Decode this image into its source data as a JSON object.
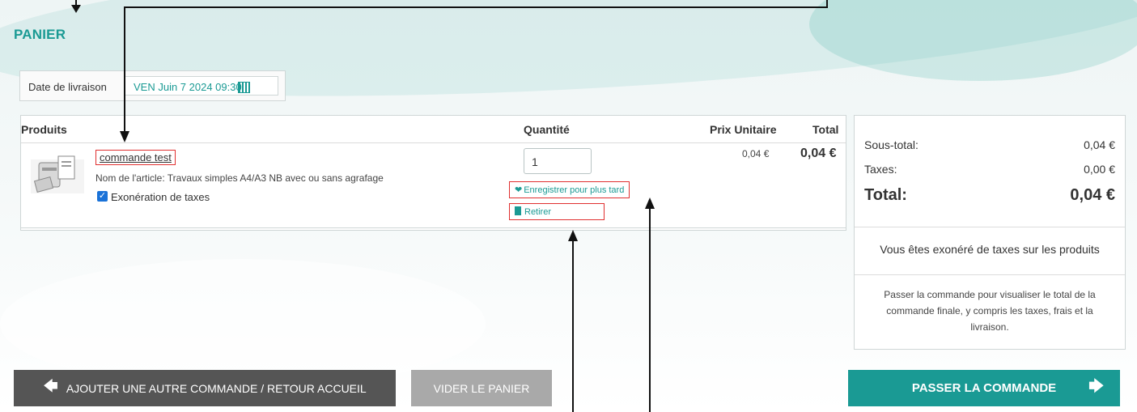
{
  "page": {
    "title": "PANIER"
  },
  "delivery": {
    "label": "Date de livraison",
    "value": "VEN Juin 7 2024 09:30"
  },
  "table": {
    "headers": {
      "products": "Produits",
      "quantity": "Quantité",
      "unit_price": "Prix Unitaire",
      "total": "Total"
    },
    "rows": [
      {
        "name": "commande test",
        "item": "Nom de l'article: Travaux simples A4/A3 NB avec ou sans agrafage",
        "tax_exempt_label": "Exonération de taxes",
        "tax_exempt_checked": true,
        "quantity": "1",
        "save_later": "Enregistrer pour plus tard",
        "remove": "Retirer",
        "unit_price": "0,04 €",
        "total": "0,04 €"
      }
    ]
  },
  "summary": {
    "subtotal_label": "Sous-total:",
    "subtotal": "0,04 €",
    "taxes_label": "Taxes:",
    "taxes": "0,00 €",
    "total_label": "Total:",
    "total": "0,04 €",
    "exempt_note": "Vous êtes exonéré de taxes sur les produits",
    "checkout_note": "Passer la commande pour visualiser le total de la commande finale, y compris les taxes, frais et la livraison."
  },
  "buttons": {
    "back": "AJOUTER UNE AUTRE COMMANDE / RETOUR ACCUEIL",
    "empty": "VIDER LE PANIER",
    "order": "PASSER LA COMMANDE"
  },
  "colors": {
    "accent": "#1a9a94",
    "highlight": "#e03030",
    "button_dark": "#555555",
    "button_gray": "#a9a9a9"
  },
  "icons": [
    "calendar-icon",
    "heart-icon",
    "trash-icon",
    "arrow-left-icon",
    "arrow-right-icon",
    "checkbox-icon"
  ]
}
